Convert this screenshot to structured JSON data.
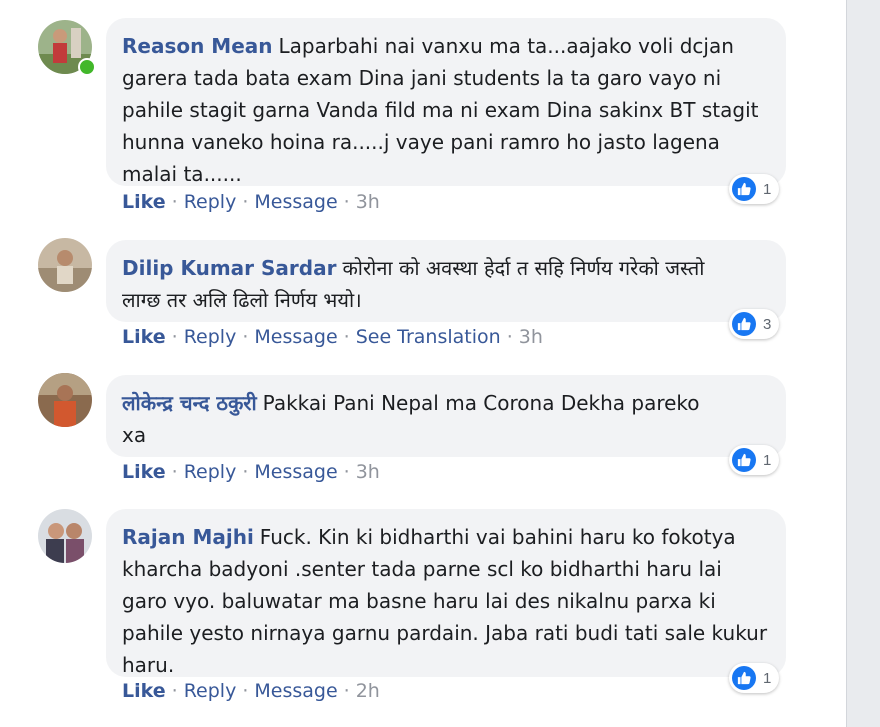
{
  "comments": [
    {
      "author": "Reason Mean",
      "text": "Laparbahi nai vanxu ma ta...aajako voli dcjan garera tada bata exam Dina jani students la ta garo vayo ni pahile stagit garna Vanda fild ma ni exam Dina sakinx BT stagit hunna vaneko hoina ra.....j vaye pani ramro ho jasto lagena malai ta......",
      "lines": [
        "Laparbahi nai vanxu ma ta...aajako voli dcjan",
        "garera tada bata exam Dina jani students la ta garo vayo ni",
        "pahile stagit garna Vanda fild ma ni exam Dina sakinx BT stagit",
        "hunna vaneko hoina ra.....j vaye pani ramro ho jasto lagena",
        "malai ta......"
      ],
      "reaction_count": "1",
      "actions": {
        "like": "Like",
        "reply": "Reply",
        "message": "Message"
      },
      "time": "3h",
      "online": true
    },
    {
      "author": "Dilip Kumar Sardar",
      "text": "कोरोना को अवस्था हेर्दा त सहि निर्णय गरेको जस्तो लाग्छ तर अलि ढिलो निर्णय भयो।",
      "lines": [
        "कोरोना को अवस्था हेर्दा त सहि निर्णय गरेको जस्तो",
        "लाग्छ तर अलि ढिलो निर्णय भयो।"
      ],
      "reaction_count": "3",
      "actions": {
        "like": "Like",
        "reply": "Reply",
        "message": "Message",
        "translate": "See Translation"
      },
      "time": "3h",
      "online": false
    },
    {
      "author": "लोकेन्द्र चन्द ठकुरी",
      "text": "Pakkai Pani Nepal ma Corona Dekha pareko xa",
      "lines": [
        "Pakkai Pani Nepal ma Corona Dekha pareko",
        "xa"
      ],
      "reaction_count": "1",
      "actions": {
        "like": "Like",
        "reply": "Reply",
        "message": "Message"
      },
      "time": "3h",
      "online": false
    },
    {
      "author": "Rajan Majhi",
      "text": "Fuck. Kin ki bidharthi vai bahini haru ko fokotya kharcha badyoni .senter tada parne scl ko bidharthi haru lai garo vyo. baluwatar ma basne haru lai des nikalnu parxa ki pahile yesto nirnaya garnu pardain. Jaba rati budi tati sale kukur haru.",
      "lines": [
        "Fuck. Kin ki bidharthi vai bahini haru ko fokotya",
        "kharcha badyoni .senter tada parne scl ko bidharthi haru lai",
        "garo vyo. baluwatar ma basne haru lai des nikalnu parxa ki",
        "pahile yesto nirnaya garnu pardain. Jaba rati budi tati sale kukur",
        "haru."
      ],
      "reaction_count": "1",
      "actions": {
        "like": "Like",
        "reply": "Reply",
        "message": "Message"
      },
      "time": "2h",
      "online": false
    }
  ],
  "colors": {
    "author": "#385898",
    "bubble": "#f2f3f5",
    "meta": "#90949c",
    "like_badge": "#1877f2",
    "online": "#42b72a"
  },
  "icons": {
    "reaction": "thumbs-up-icon",
    "presence": "online-status-icon"
  }
}
